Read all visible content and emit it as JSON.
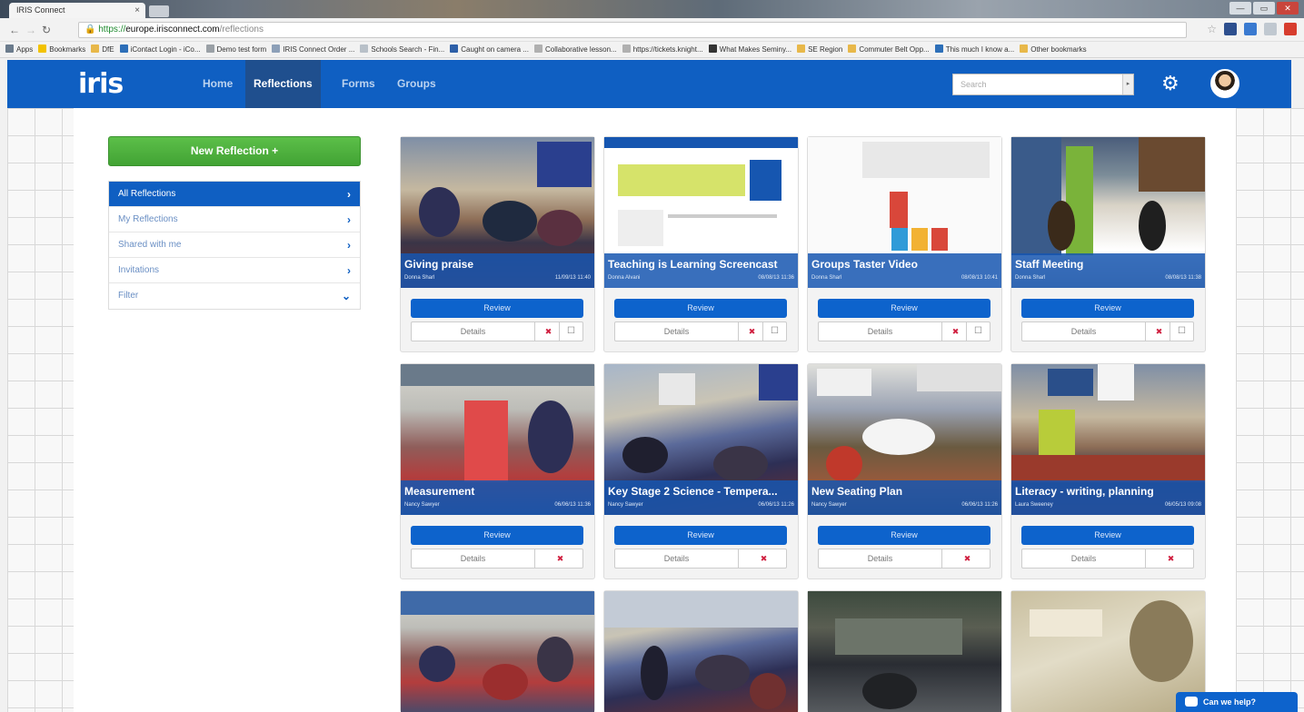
{
  "browser": {
    "tab_title": "IRIS Connect",
    "tab_close": "×",
    "window_controls": [
      "—",
      "▭",
      "✕"
    ],
    "url_scheme": "https://",
    "url_host": "europe.irisconnect.com",
    "url_path": "/reflections",
    "bookmarks": [
      {
        "label": "Apps",
        "color": "#6b7b8c"
      },
      {
        "label": "Bookmarks",
        "color": "#f2c200"
      },
      {
        "label": "DfE",
        "color": "#e8b84a"
      },
      {
        "label": "iContact Login - iCo...",
        "color": "#2d6fb8"
      },
      {
        "label": "Demo test form",
        "color": "#9aa0a6"
      },
      {
        "label": "IRIS Connect Order ...",
        "color": "#8da0b8"
      },
      {
        "label": "Schools Search - Fin...",
        "color": "#b8c0c8"
      },
      {
        "label": "Caught on camera ...",
        "color": "#2d5fa8"
      },
      {
        "label": "Collaborative lesson...",
        "color": "#b0b0b0"
      },
      {
        "label": "https://tickets.knight...",
        "color": "#b0b0b0"
      },
      {
        "label": "What Makes Seminy...",
        "color": "#333333"
      },
      {
        "label": "SE Region",
        "color": "#e8b84a"
      },
      {
        "label": "Commuter Belt Opp...",
        "color": "#e8b84a"
      },
      {
        "label": "This much I know a...",
        "color": "#2d6fb8"
      },
      {
        "label": "Other bookmarks",
        "color": "#e8b84a"
      }
    ]
  },
  "nav": {
    "logo": "iris",
    "links": [
      "Home",
      "Reflections",
      "Forms",
      "Groups"
    ],
    "active": "Reflections",
    "search_placeholder": "Search"
  },
  "sidebar": {
    "new_button": "New Reflection +",
    "items": [
      {
        "label": "All Reflections",
        "chevron": "›"
      },
      {
        "label": "My Reflections",
        "chevron": "›"
      },
      {
        "label": "Shared with me",
        "chevron": "›"
      },
      {
        "label": "Invitations",
        "chevron": "›"
      },
      {
        "label": "Filter",
        "chevron": "⌄"
      }
    ]
  },
  "cards": [
    {
      "title": "Giving praise",
      "author": "Donna Sharl",
      "date": "11/09/13 11:40",
      "review": "Review",
      "details": "Details",
      "delete": "✖",
      "share": "☐"
    },
    {
      "title": "Teaching is Learning Screencast",
      "author": "Donna Alvani",
      "date": "08/08/13 11:36",
      "review": "Review",
      "details": "Details",
      "delete": "✖",
      "share": "☐"
    },
    {
      "title": "Groups Taster Video",
      "author": "Donna Sharl",
      "date": "08/08/13 10:41",
      "review": "Review",
      "details": "Details",
      "delete": "✖",
      "share": "☐"
    },
    {
      "title": "Staff Meeting",
      "author": "Donna Sharl",
      "date": "08/08/13 11:38",
      "review": "Review",
      "details": "Details",
      "delete": "✖",
      "share": "☐"
    },
    {
      "title": "Measurement",
      "author": "Nancy Sawyer",
      "date": "06/06/13 11:36",
      "review": "Review",
      "details": "Details",
      "delete": "✖"
    },
    {
      "title": "Key Stage 2 Science - Tempera...",
      "author": "Nancy Sawyer",
      "date": "06/06/13 11:26",
      "review": "Review",
      "details": "Details",
      "delete": "✖"
    },
    {
      "title": "New Seating Plan",
      "author": "Nancy Sawyer",
      "date": "06/06/13 11:26",
      "review": "Review",
      "details": "Details",
      "delete": "✖"
    },
    {
      "title": "Literacy - writing, planning",
      "author": "Laura Sweeney",
      "date": "06/05/13 09:08",
      "review": "Review",
      "details": "Details",
      "delete": "✖"
    }
  ],
  "help": "Can we help?"
}
